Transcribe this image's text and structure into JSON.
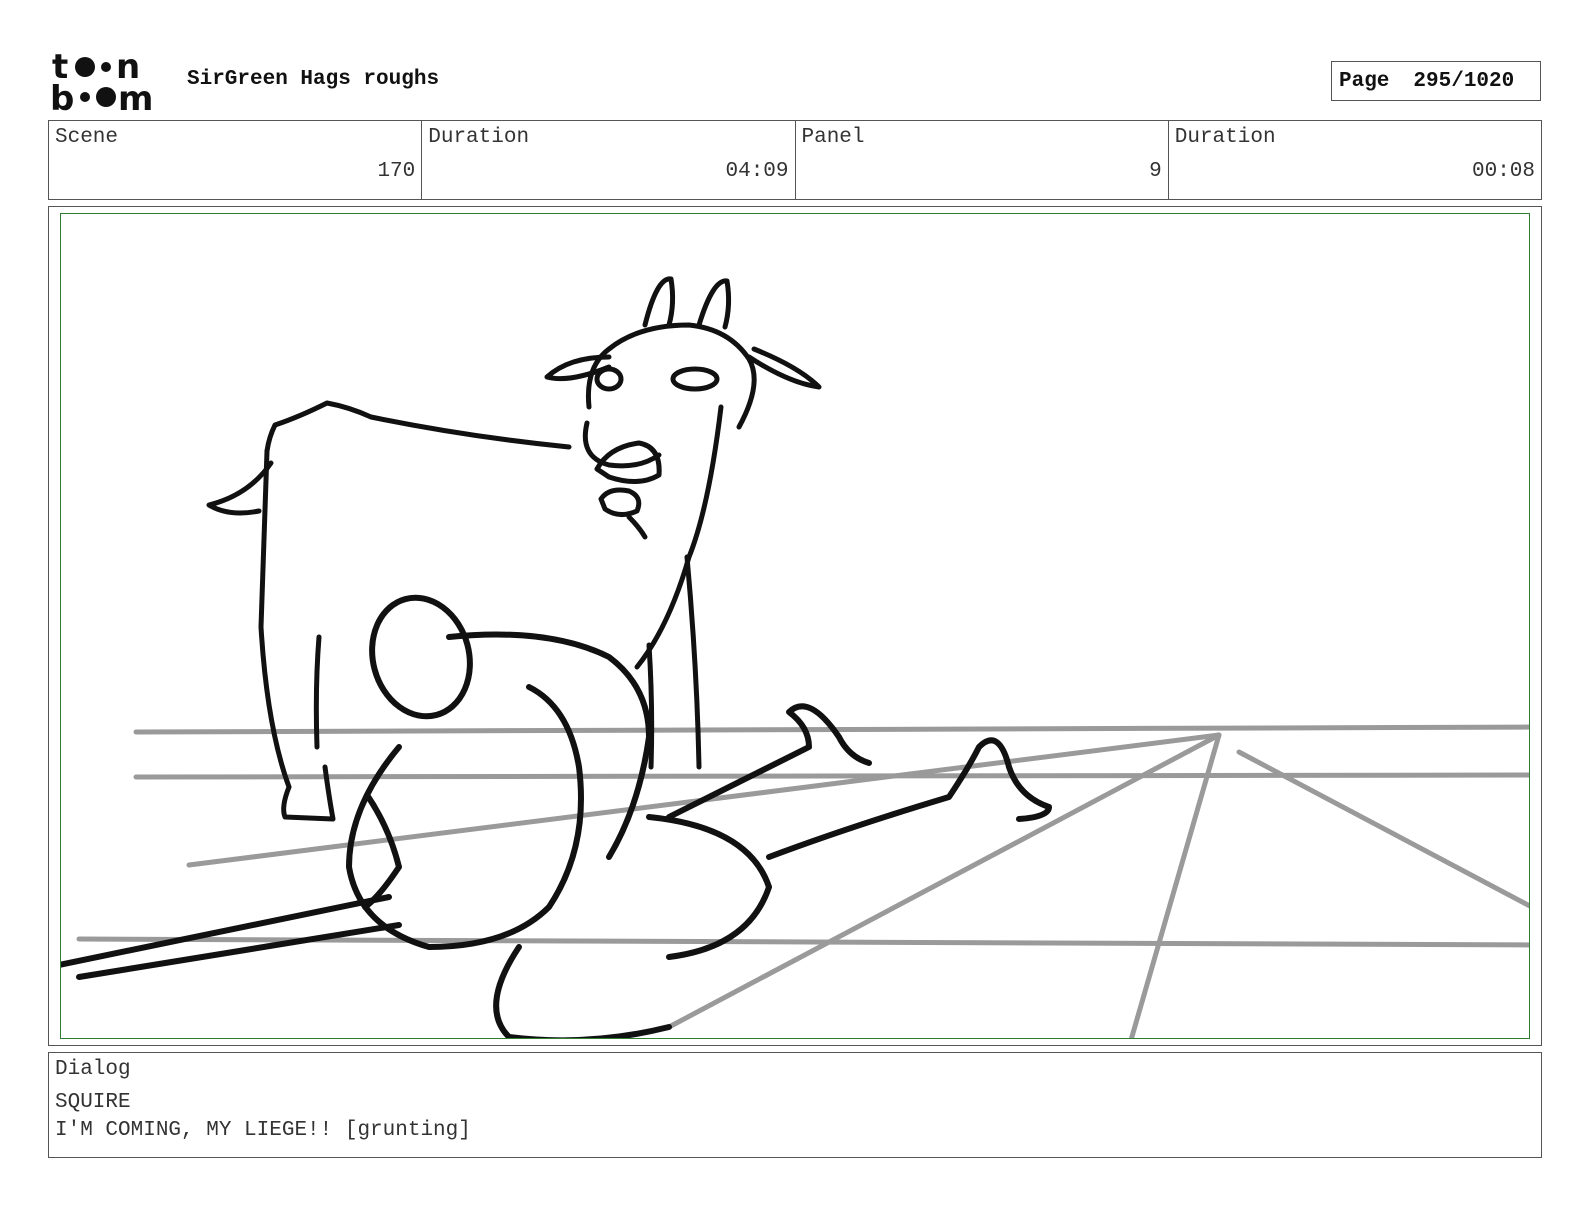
{
  "header": {
    "logo_text": "toon boom",
    "title": "SirGreen Hags roughs",
    "page_label": "Page",
    "page_value": "295/1020"
  },
  "info": [
    {
      "label": "Scene",
      "value": "170"
    },
    {
      "label": "Duration",
      "value": "04:09"
    },
    {
      "label": "Panel",
      "value": "9"
    },
    {
      "label": "Duration",
      "value": "00:08"
    }
  ],
  "panel": {
    "icon": "storyboard-sketch-goat-and-squire",
    "frame_color": "#2f7d2f"
  },
  "dialog": {
    "label": "Dialog",
    "speaker": "SQUIRE",
    "line": "I'M COMING, MY LIEGE!! [grunting]"
  }
}
